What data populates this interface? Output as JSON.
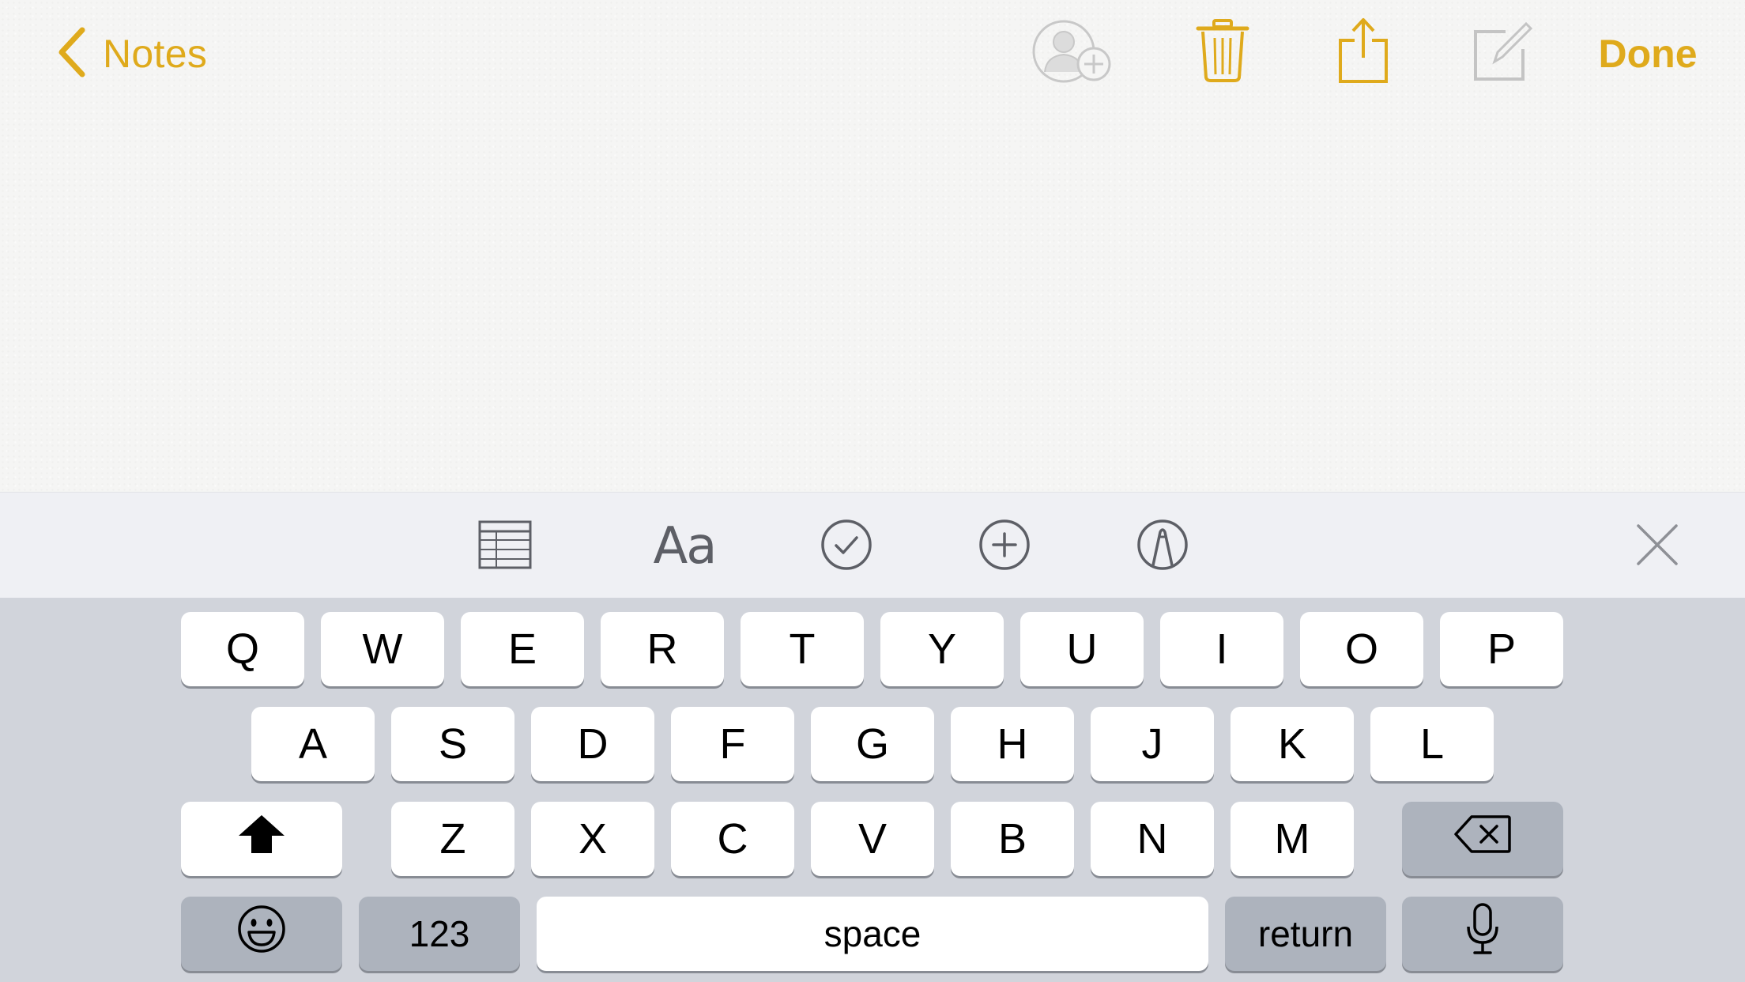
{
  "nav": {
    "back_label": "Notes",
    "done_label": "Done",
    "accent_color": "#dfaa1c",
    "icons": [
      "chevron-left-icon",
      "add-people-icon",
      "trash-icon",
      "share-icon",
      "compose-icon"
    ]
  },
  "format_bar": {
    "text_style_label": "Aa",
    "icons": [
      "table-icon",
      "text-style-icon",
      "checklist-icon",
      "add-icon",
      "markup-icon",
      "close-icon"
    ]
  },
  "keyboard": {
    "row1": [
      "Q",
      "W",
      "E",
      "R",
      "T",
      "Y",
      "U",
      "I",
      "O",
      "P"
    ],
    "row2": [
      "A",
      "S",
      "D",
      "F",
      "G",
      "H",
      "J",
      "K",
      "L"
    ],
    "row3": [
      "Z",
      "X",
      "C",
      "V",
      "B",
      "N",
      "M"
    ],
    "numbers_label": "123",
    "space_label": "space",
    "return_label": "return",
    "icons": [
      "shift-icon",
      "delete-icon",
      "emoji-icon",
      "microphone-icon"
    ]
  }
}
